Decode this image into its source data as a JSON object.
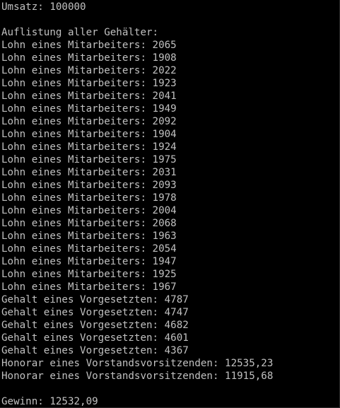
{
  "console": {
    "lines": [
      "Umsatz: 100000",
      "",
      "Auflistung aller Gehälter:",
      "Lohn eines Mitarbeiters: 2065",
      "Lohn eines Mitarbeiters: 1908",
      "Lohn eines Mitarbeiters: 2022",
      "Lohn eines Mitarbeiters: 1923",
      "Lohn eines Mitarbeiters: 2041",
      "Lohn eines Mitarbeiters: 1949",
      "Lohn eines Mitarbeiters: 2092",
      "Lohn eines Mitarbeiters: 1904",
      "Lohn eines Mitarbeiters: 1924",
      "Lohn eines Mitarbeiters: 1975",
      "Lohn eines Mitarbeiters: 2031",
      "Lohn eines Mitarbeiters: 2093",
      "Lohn eines Mitarbeiters: 1978",
      "Lohn eines Mitarbeiters: 2004",
      "Lohn eines Mitarbeiters: 2068",
      "Lohn eines Mitarbeiters: 1963",
      "Lohn eines Mitarbeiters: 2054",
      "Lohn eines Mitarbeiters: 1947",
      "Lohn eines Mitarbeiters: 1925",
      "Lohn eines Mitarbeiters: 1967",
      "Gehalt eines Vorgesetzten: 4787",
      "Gehalt eines Vorgesetzten: 4747",
      "Gehalt eines Vorgesetzten: 4682",
      "Gehalt eines Vorgesetzten: 4601",
      "Gehalt eines Vorgesetzten: 4367",
      "Honorar eines Vorstandsvorsitzenden: 12535,23",
      "Honorar eines Vorstandsvorsitzenden: 11915,68",
      "",
      "Gewinn: 12532,09"
    ],
    "text_color": "#c0c0c0",
    "background_color": "#000000"
  }
}
